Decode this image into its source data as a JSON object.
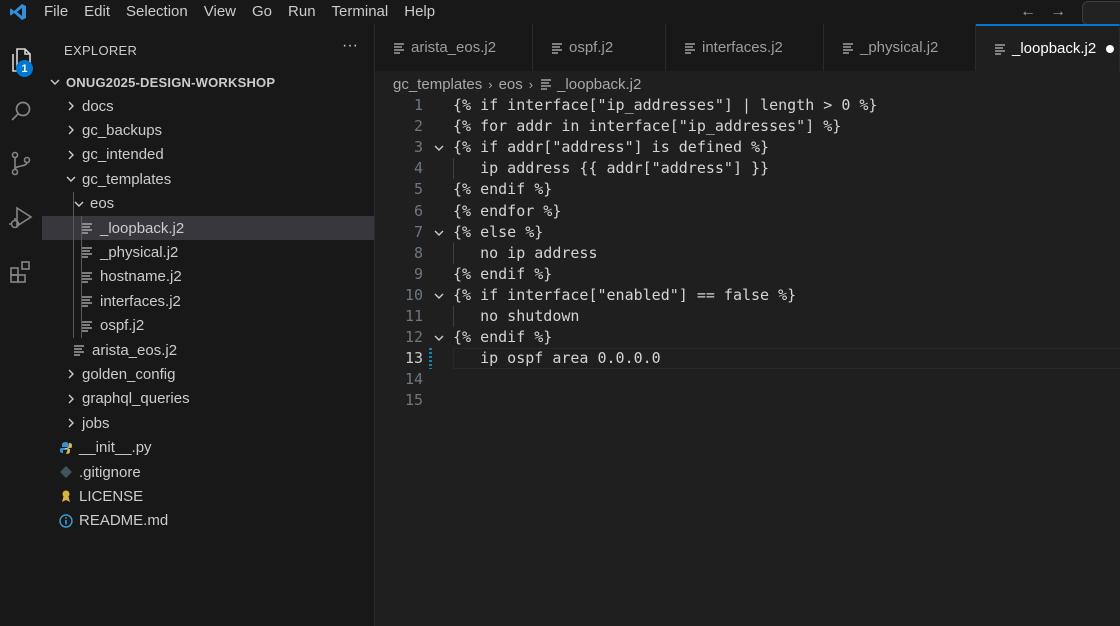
{
  "menubar": {
    "items": [
      "File",
      "Edit",
      "Selection",
      "View",
      "Go",
      "Run",
      "Terminal",
      "Help"
    ],
    "back_icon": "arrow-left-icon",
    "forward_icon": "arrow-right-icon"
  },
  "activity_bar": {
    "items": [
      "explorer-icon",
      "search-icon",
      "source-control-icon",
      "run-debug-icon",
      "extensions-icon"
    ],
    "explorer_badge": "1"
  },
  "sidebar": {
    "title": "EXPLORER",
    "more": "···",
    "root": "ONUG2025-DESIGN-WORKSHOP",
    "tree": [
      {
        "label": "docs",
        "type": "folder",
        "expanded": false,
        "depth": 1
      },
      {
        "label": "gc_backups",
        "type": "folder",
        "expanded": false,
        "depth": 1
      },
      {
        "label": "gc_intended",
        "type": "folder",
        "expanded": false,
        "depth": 1
      },
      {
        "label": "gc_templates",
        "type": "folder",
        "expanded": true,
        "depth": 1
      },
      {
        "label": "eos",
        "type": "folder",
        "expanded": true,
        "depth": 2
      },
      {
        "label": "_loopback.j2",
        "type": "file",
        "depth": 3,
        "selected": true
      },
      {
        "label": "_physical.j2",
        "type": "file",
        "depth": 3
      },
      {
        "label": "hostname.j2",
        "type": "file",
        "depth": 3
      },
      {
        "label": "interfaces.j2",
        "type": "file",
        "depth": 3
      },
      {
        "label": "ospf.j2",
        "type": "file",
        "depth": 3
      },
      {
        "label": "arista_eos.j2",
        "type": "file",
        "depth": 2
      },
      {
        "label": "golden_config",
        "type": "folder",
        "expanded": false,
        "depth": 1
      },
      {
        "label": "graphql_queries",
        "type": "folder",
        "expanded": false,
        "depth": 1
      },
      {
        "label": "jobs",
        "type": "folder",
        "expanded": false,
        "depth": 1
      },
      {
        "label": "__init__.py",
        "type": "python",
        "depth": 1
      },
      {
        "label": ".gitignore",
        "type": "git",
        "depth": 1
      },
      {
        "label": "LICENSE",
        "type": "license",
        "depth": 1
      },
      {
        "label": "README.md",
        "type": "info",
        "depth": 1
      }
    ]
  },
  "tabs": [
    {
      "label": "arista_eos.j2",
      "active": false
    },
    {
      "label": "ospf.j2",
      "active": false
    },
    {
      "label": "interfaces.j2",
      "active": false
    },
    {
      "label": "_physical.j2",
      "active": false
    },
    {
      "label": "_loopback.j2",
      "active": true,
      "dirty": true
    }
  ],
  "breadcrumb": [
    "gc_templates",
    "eos",
    "_loopback.j2"
  ],
  "editor": {
    "current_line": 13,
    "lines": [
      {
        "n": "1",
        "text": "{% if interface[\"ip_addresses\"] | length > 0 %}",
        "fold": false
      },
      {
        "n": "2",
        "text": "{% for addr in interface[\"ip_addresses\"] %}",
        "fold": false
      },
      {
        "n": "3",
        "text": "{% if addr[\"address\"] is defined %}",
        "fold": true
      },
      {
        "n": "4",
        "text": "   ip address {{ addr[\"address\"] }}",
        "fold": false
      },
      {
        "n": "5",
        "text": "{% endif %}",
        "fold": false
      },
      {
        "n": "6",
        "text": "{% endfor %}",
        "fold": false
      },
      {
        "n": "7",
        "text": "{% else %}",
        "fold": true
      },
      {
        "n": "8",
        "text": "   no ip address",
        "fold": false
      },
      {
        "n": "9",
        "text": "{% endif %}",
        "fold": false
      },
      {
        "n": "10",
        "text": "{% if interface[\"enabled\"] == false %}",
        "fold": true
      },
      {
        "n": "11",
        "text": "   no shutdown",
        "fold": false
      },
      {
        "n": "12",
        "text": "{% endif %}",
        "fold": true
      },
      {
        "n": "13",
        "text": "   ip ospf area 0.0.0.0",
        "fold": false
      },
      {
        "n": "14",
        "text": "",
        "fold": false
      },
      {
        "n": "15",
        "text": "",
        "fold": false
      }
    ]
  },
  "colors": {
    "accent": "#0078d4",
    "selected_row": "#37373d",
    "background": "#1f1f1f"
  }
}
